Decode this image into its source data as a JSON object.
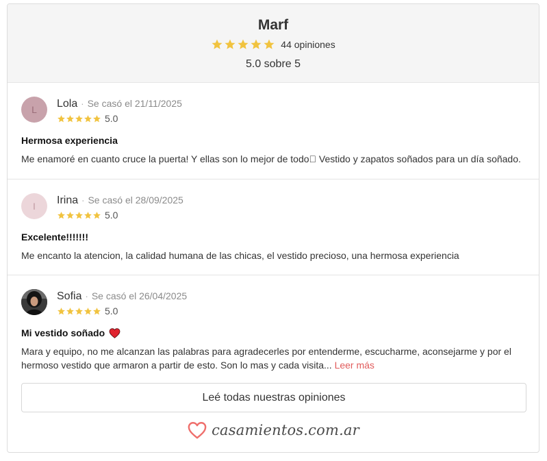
{
  "business": {
    "name": "Marf",
    "stars": 5,
    "review_count_label": "44 opiniones",
    "score_label": "5.0 sobre 5"
  },
  "colors": {
    "star": "#f1c33f",
    "accent": "#e15b5b"
  },
  "reviews": [
    {
      "avatar_initial": "L",
      "name": "Lola",
      "separator": "·",
      "married": "Se casó el 21/11/2025",
      "stars": 5,
      "rating": "5.0",
      "title": "Hermosa experiencia",
      "text": "Me enamoré en cuanto cruce la puerta! Y ellas son lo mejor de todo􏿾 Vestido y zapatos soñados para un día soñado."
    },
    {
      "avatar_initial": "I",
      "name": "Irina",
      "separator": "·",
      "married": "Se casó el 28/09/2025",
      "stars": 5,
      "rating": "5.0",
      "title": "Excelente!!!!!!!",
      "text": "Me encanto la atencion, la calidad humana de las chicas, el vestido precioso, una hermosa experiencia"
    },
    {
      "avatar_icon": "photo-avatar",
      "name": "Sofia",
      "separator": "·",
      "married": "Se casó el 26/04/2025",
      "stars": 5,
      "rating": "5.0",
      "title": "Mi vestido soñado",
      "title_icon": "red-heart-icon",
      "text": "Mara y equipo, no me alcanzan las palabras para agradecerles por entenderme, escucharme, aconsejarme y por el hermoso vestido que armaron a partir de esto. Son lo mas y cada visita...",
      "more_label": "Leer más"
    }
  ],
  "all_reviews_button": "Leé todas nuestras opiniones",
  "footer": {
    "logo_icon": "heart-outline-icon",
    "brand": "casamientos.com.ar"
  }
}
